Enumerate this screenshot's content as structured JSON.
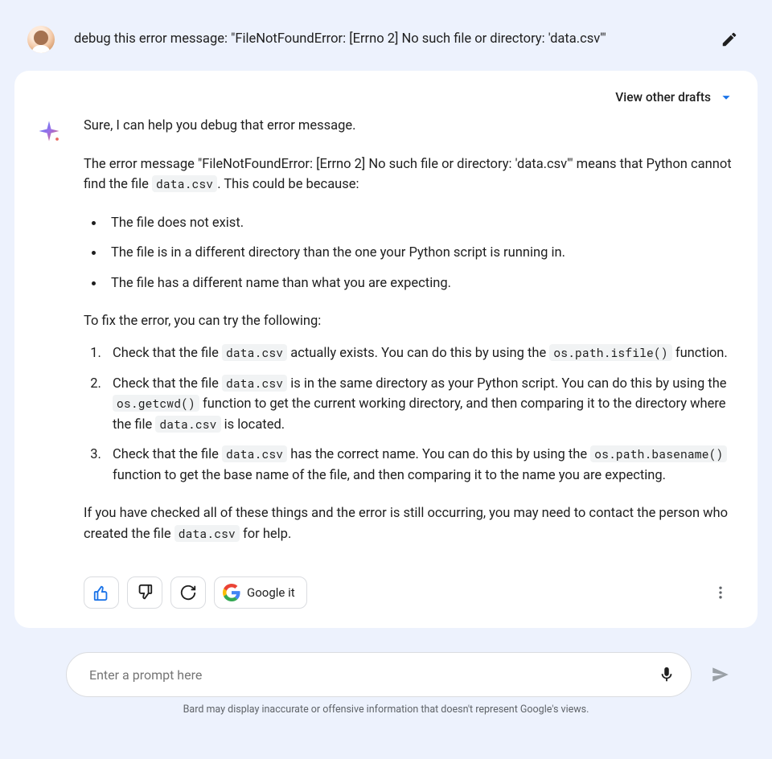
{
  "user": {
    "prompt": "debug this error message: \"FileNotFoundError: [Errno 2] No such file or directory: 'data.csv'\""
  },
  "response": {
    "drafts_label": "View other drafts",
    "intro": "Sure, I can help you debug that error message.",
    "explain_pre": "The error message \"FileNotFoundError: [Errno 2] No such file or directory: 'data.csv'\" means that Python cannot find the file ",
    "explain_code": "data.csv",
    "explain_post": ". This could be because:",
    "bullets": [
      "The file does not exist.",
      "The file is in a different directory than the one your Python script is running in.",
      "The file has a different name than what you are expecting."
    ],
    "fix_intro": "To fix the error, you can try the following:",
    "steps": [
      {
        "pre1": "Check that the file ",
        "code1": "data.csv",
        "mid1": " actually exists. You can do this by using the ",
        "code2": "os.path.isfile()",
        "post1": " function."
      },
      {
        "pre1": "Check that the file ",
        "code1": "data.csv",
        "mid1": " is in the same directory as your Python script. You can do this by using the ",
        "code2": "os.getcwd()",
        "mid2": " function to get the current working directory, and then comparing it to the directory where the file ",
        "code3": "data.csv",
        "post1": " is located."
      },
      {
        "pre1": "Check that the file ",
        "code1": "data.csv",
        "mid1": " has the correct name. You can do this by using the ",
        "code2": "os.path.basename()",
        "post1": " function to get the base name of the file, and then comparing it to the name you are expecting."
      }
    ],
    "closing_pre": "If you have checked all of these things and the error is still occurring, you may need to contact the person who created the file ",
    "closing_code": "data.csv",
    "closing_post": " for help.",
    "google_it": "Google it"
  },
  "input": {
    "placeholder": "Enter a prompt here"
  },
  "disclaimer": "Bard may display inaccurate or offensive information that doesn't represent Google's views."
}
